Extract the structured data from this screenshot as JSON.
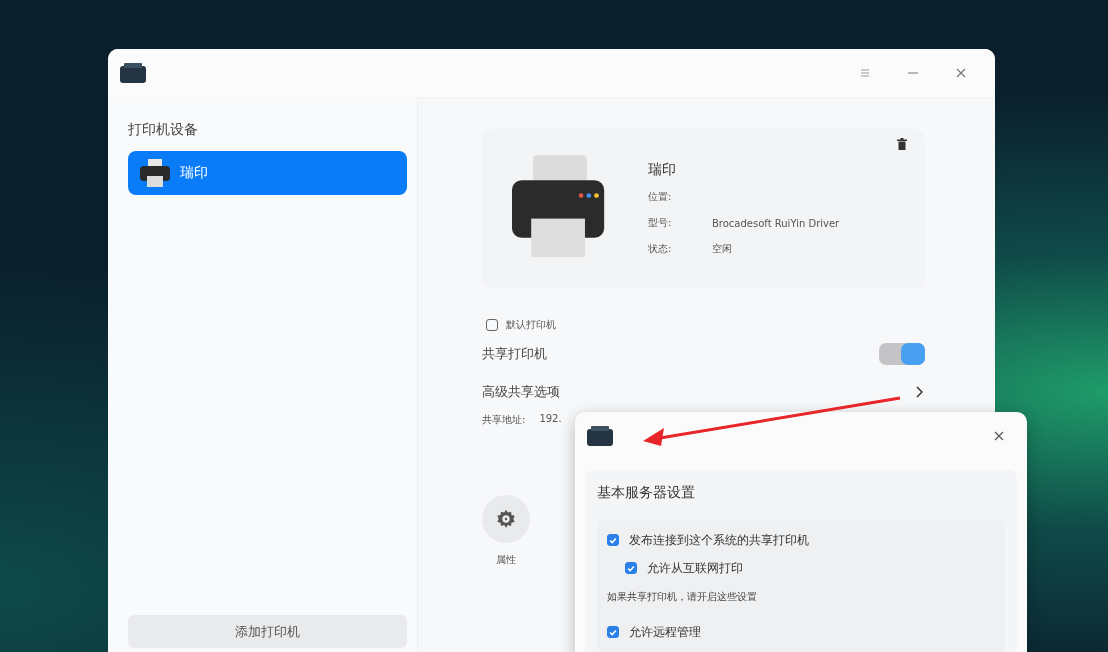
{
  "sidebar": {
    "title": "打印机设备",
    "items": [
      {
        "label": "瑞印",
        "selected": true
      }
    ],
    "add_button": "添加打印机"
  },
  "printer": {
    "name": "瑞印",
    "fields": [
      {
        "label": "位置:"
      },
      {
        "label": "型号:",
        "value": "Brocadesoft RuiYin Driver"
      },
      {
        "label": "状态:",
        "value": "空闲"
      }
    ]
  },
  "settings": {
    "default_printer": {
      "label": "默认打印机",
      "checked": false
    },
    "share_printer": {
      "label": "共享打印机",
      "on": true
    },
    "advanced_sharing": "高级共享选项",
    "share_address": {
      "label": "共享地址:",
      "value": "192."
    }
  },
  "properties_button": "属性",
  "dialog": {
    "section_title": "基本服务器设置",
    "options": [
      {
        "kind": "checkbox",
        "label": "发布连接到这个系统的共享打印机",
        "checked": true,
        "children": [
          {
            "kind": "checkbox",
            "label": "允许从互联网打印",
            "checked": true
          }
        ]
      },
      {
        "kind": "note",
        "label": "如果共享打印机，请开启这些设置"
      },
      {
        "kind": "checkbox",
        "label": "允许远程管理",
        "checked": true
      }
    ]
  }
}
